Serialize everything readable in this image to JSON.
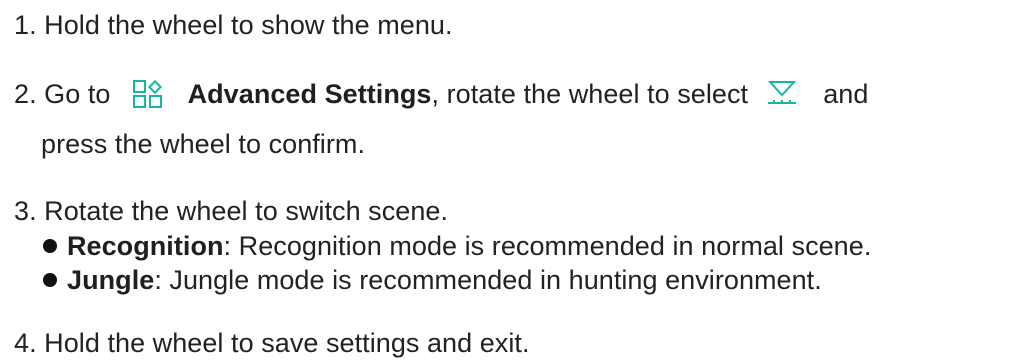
{
  "instructions": {
    "step1": {
      "text": "1. Hold the wheel to show the menu."
    },
    "step2": {
      "prefix": "2. Go to",
      "menu_name": "Advanced Settings",
      "middle": ", rotate the wheel to select",
      "suffix": "and",
      "line2": "press the wheel to confirm.",
      "icon_advanced": "advanced-settings-icon",
      "icon_scene": "scene-mode-icon"
    },
    "step3": {
      "text": "3. Rotate the wheel to switch scene.",
      "bullets": [
        {
          "term": "Recognition",
          "desc": ": Recognition mode is recommended in normal scene."
        },
        {
          "term": "Jungle",
          "desc": ": Jungle mode is recommended in hunting environment."
        }
      ]
    },
    "step4": {
      "text": "4. Hold the wheel to save settings and exit."
    }
  },
  "colors": {
    "text": "#222222",
    "icon_accent": "#18b6a2"
  }
}
